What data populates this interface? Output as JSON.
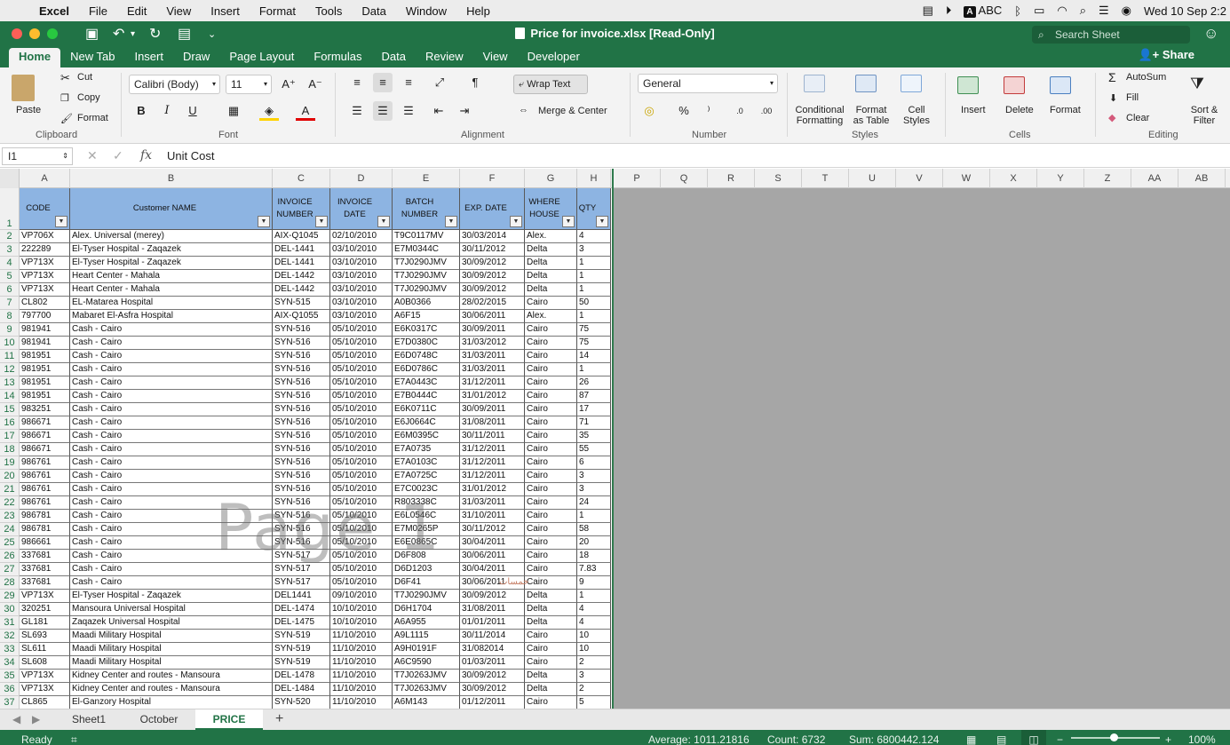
{
  "menubar": {
    "app": "Excel",
    "items": [
      "File",
      "Edit",
      "View",
      "Insert",
      "Format",
      "Tools",
      "Data",
      "Window",
      "Help"
    ],
    "input_source": "ABC",
    "datetime": "Wed 10 Sep  2:2"
  },
  "window": {
    "title": "Price for invoice.xlsx  [Read-Only]",
    "search_placeholder": "Search Sheet",
    "share_label": "Share"
  },
  "tabs": [
    "Home",
    "New Tab",
    "Insert",
    "Draw",
    "Page Layout",
    "Formulas",
    "Data",
    "Review",
    "View",
    "Developer"
  ],
  "ribbon": {
    "clipboard": {
      "paste": "Paste",
      "cut": "Cut",
      "copy": "Copy",
      "format": "Format",
      "label": "Clipboard"
    },
    "font": {
      "name": "Calibri (Body)",
      "size": "11",
      "label": "Font"
    },
    "alignment": {
      "wrap": "Wrap Text",
      "merge": "Merge & Center",
      "label": "Alignment"
    },
    "number": {
      "format": "General",
      "label": "Number"
    },
    "styles": {
      "conditional": "Conditional Formatting",
      "format_table": "Format as Table",
      "cell_styles": "Cell Styles",
      "label": "Styles"
    },
    "cells": {
      "insert": "Insert",
      "delete": "Delete",
      "format": "Format",
      "label": "Cells"
    },
    "editing": {
      "autosum": "AutoSum",
      "fill": "Fill",
      "clear": "Clear",
      "sort": "Sort & Filter",
      "label": "Editing"
    }
  },
  "formula_bar": {
    "cell_ref": "I1",
    "content": "Unit Cost"
  },
  "columns": [
    "A",
    "B",
    "C",
    "D",
    "E",
    "F",
    "G",
    "H",
    "P",
    "Q",
    "R",
    "S",
    "T",
    "U",
    "V",
    "W",
    "X",
    "Y",
    "Z",
    "AA",
    "AB"
  ],
  "headers": [
    "CODE",
    "Customer  NAME",
    "INVOICE NUMBER",
    "INVOICE DATE",
    "BATCH NUMBER",
    "EXP. DATE",
    "WHERE HOUSE",
    "QTY"
  ],
  "rows": [
    [
      "VP706X",
      "Alex. Universal  (merey)",
      "AIX-Q1045",
      "02/10/2010",
      "T9C0117MV",
      "30/03/2014",
      "Alex.",
      "4"
    ],
    [
      "222289",
      "El-Tyser Hospital - Zaqazek",
      "DEL-1441",
      "03/10/2010",
      "E7M0344C",
      "30/11/2012",
      "Delta",
      "3"
    ],
    [
      "VP713X",
      "El-Tyser Hospital - Zaqazek",
      "DEL-1441",
      "03/10/2010",
      "T7J0290JMV",
      "30/09/2012",
      "Delta",
      "1"
    ],
    [
      "VP713X",
      "Heart Center - Mahala",
      "DEL-1442",
      "03/10/2010",
      "T7J0290JMV",
      "30/09/2012",
      "Delta",
      "1"
    ],
    [
      "VP713X",
      "Heart Center - Mahala",
      "DEL-1442",
      "03/10/2010",
      "T7J0290JMV",
      "30/09/2012",
      "Delta",
      "1"
    ],
    [
      "CL802",
      "EL-Matarea Hospital",
      "SYN-515",
      "03/10/2010",
      "A0B0366",
      "28/02/2015",
      "Cairo",
      "50"
    ],
    [
      "797700",
      "Mabaret El-Asfra Hospital",
      "AIX-Q1055",
      "03/10/2010",
      "A6F15",
      "30/06/2011",
      "Alex.",
      "1"
    ],
    [
      "981941",
      "Cash - Cairo",
      "SYN-516",
      "05/10/2010",
      "E6K0317C",
      "30/09/2011",
      "Cairo",
      "75"
    ],
    [
      "981941",
      "Cash - Cairo",
      "SYN-516",
      "05/10/2010",
      "E7D0380C",
      "31/03/2012",
      "Cairo",
      "75"
    ],
    [
      "981951",
      "Cash - Cairo",
      "SYN-516",
      "05/10/2010",
      "E6D0748C",
      "31/03/2011",
      "Cairo",
      "14"
    ],
    [
      "981951",
      "Cash - Cairo",
      "SYN-516",
      "05/10/2010",
      "E6D0786C",
      "31/03/2011",
      "Cairo",
      "1"
    ],
    [
      "981951",
      "Cash - Cairo",
      "SYN-516",
      "05/10/2010",
      "E7A0443C",
      "31/12/2011",
      "Cairo",
      "26"
    ],
    [
      "981951",
      "Cash - Cairo",
      "SYN-516",
      "05/10/2010",
      "E7B0444C",
      "31/01/2012",
      "Cairo",
      "87"
    ],
    [
      "983251",
      "Cash - Cairo",
      "SYN-516",
      "05/10/2010",
      "E6K0711C",
      "30/09/2011",
      "Cairo",
      "17"
    ],
    [
      "986671",
      "Cash - Cairo",
      "SYN-516",
      "05/10/2010",
      "E6J0664C",
      "31/08/2011",
      "Cairo",
      "71"
    ],
    [
      "986671",
      "Cash - Cairo",
      "SYN-516",
      "05/10/2010",
      "E6M0395C",
      "30/11/2011",
      "Cairo",
      "35"
    ],
    [
      "986671",
      "Cash - Cairo",
      "SYN-516",
      "05/10/2010",
      "E7A0735",
      "31/12/2011",
      "Cairo",
      "55"
    ],
    [
      "986761",
      "Cash - Cairo",
      "SYN-516",
      "05/10/2010",
      "E7A0103C",
      "31/12/2011",
      "Cairo",
      "6"
    ],
    [
      "986761",
      "Cash - Cairo",
      "SYN-516",
      "05/10/2010",
      "E7A0725C",
      "31/12/2011",
      "Cairo",
      "3"
    ],
    [
      "986761",
      "Cash - Cairo",
      "SYN-516",
      "05/10/2010",
      "E7C0023C",
      "31/01/2012",
      "Cairo",
      "3"
    ],
    [
      "986761",
      "Cash - Cairo",
      "SYN-516",
      "05/10/2010",
      "R803338C",
      "31/03/2011",
      "Cairo",
      "24"
    ],
    [
      "986781",
      "Cash - Cairo",
      "SYN-516",
      "05/10/2010",
      "E6L0546C",
      "31/10/2011",
      "Cairo",
      "1"
    ],
    [
      "986781",
      "Cash - Cairo",
      "SYN-516",
      "05/10/2010",
      "E7M0265P",
      "30/11/2012",
      "Cairo",
      "58"
    ],
    [
      "986661",
      "Cash - Cairo",
      "SYN-516",
      "05/10/2010",
      "E6E0865C",
      "30/04/2011",
      "Cairo",
      "20"
    ],
    [
      "337681",
      "Cash - Cairo",
      "SYN-517",
      "05/10/2010",
      "D6F808",
      "30/06/2011",
      "Cairo",
      "18"
    ],
    [
      "337681",
      "Cash - Cairo",
      "SYN-517",
      "05/10/2010",
      "D6D1203",
      "30/04/2011",
      "Cairo",
      "7.83"
    ],
    [
      "337681",
      "Cash - Cairo",
      "SYN-517",
      "05/10/2010",
      "D6F41",
      "30/06/2011",
      "Cairo",
      "9"
    ],
    [
      "VP713X",
      "El-Tyser Hospital - Zaqazek",
      "DEL1441",
      "09/10/2010",
      "T7J0290JMV",
      "30/09/2012",
      "Delta",
      "1"
    ],
    [
      "320251",
      "Mansoura Universal Hospital",
      "DEL-1474",
      "10/10/2010",
      "D6H1704",
      "31/08/2011",
      "Delta",
      "4"
    ],
    [
      "GL181",
      "Zaqazek Universal Hospital",
      "DEL-1475",
      "10/10/2010",
      "A6A955",
      "01/01/2011",
      "Delta",
      "4"
    ],
    [
      "SL693",
      "Maadi Military Hospital",
      "SYN-519",
      "11/10/2010",
      "A9L1115",
      "30/11/2014",
      "Cairo",
      "10"
    ],
    [
      "SL611",
      "Maadi Military Hospital",
      "SYN-519",
      "11/10/2010",
      "A9H0191F",
      "31/082014",
      "Cairo",
      "10"
    ],
    [
      "SL608",
      "Maadi Military Hospital",
      "SYN-519",
      "11/10/2010",
      "A6C9590",
      "01/03/2011",
      "Cairo",
      "2"
    ],
    [
      "VP713X",
      "Kidney Center and routes - Mansoura",
      "DEL-1478",
      "11/10/2010",
      "T7J0263JMV",
      "30/09/2012",
      "Delta",
      "3"
    ],
    [
      "VP713X",
      "Kidney Center and routes - Mansoura",
      "DEL-1484",
      "11/10/2010",
      "T7J0263JMV",
      "30/09/2012",
      "Delta",
      "2"
    ],
    [
      "CL865",
      "El-Ganzory  Hospital",
      "SYN-520",
      "11/10/2010",
      "A6M143",
      "01/12/2011",
      "Cairo",
      "5"
    ]
  ],
  "watermark": "Page 1",
  "sheets": [
    "Sheet1",
    "October",
    "PRICE"
  ],
  "active_sheet": "PRICE",
  "status": {
    "mode": "Ready",
    "average": "Average: 1011.21816",
    "count": "Count: 6732",
    "sum": "Sum: 6800442.124",
    "zoom": "100%"
  },
  "colors": {
    "excel_green": "#217346",
    "header_fill": "#8db4e2",
    "outside_print_area": "#a6a6a6"
  }
}
